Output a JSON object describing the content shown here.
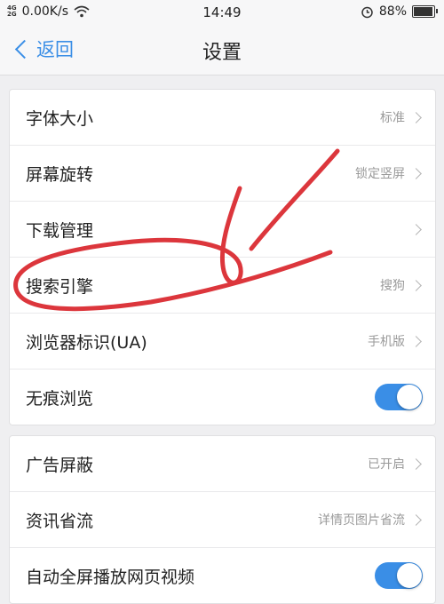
{
  "status_bar": {
    "signal_top": "4G",
    "signal_bottom": "2G",
    "net_speed": "0.00K/s",
    "time": "14:49",
    "battery": "88%",
    "battery_level": 0.88
  },
  "header": {
    "back_label": "返回",
    "title": "设置"
  },
  "group1": [
    {
      "label": "字体大小",
      "value": "标准"
    },
    {
      "label": "屏幕旋转",
      "value": "锁定竖屏"
    },
    {
      "label": "下载管理",
      "value": ""
    },
    {
      "label": "搜索引擎",
      "value": "搜狗"
    },
    {
      "label": "浏览器标识(UA)",
      "value": "手机版"
    },
    {
      "label": "无痕浏览",
      "toggle": true
    }
  ],
  "group2": [
    {
      "label": "广告屏蔽",
      "value": "已开启"
    },
    {
      "label": "资讯省流",
      "value": "详情页图片省流"
    },
    {
      "label": "自动全屏播放网页视频",
      "toggle": true
    }
  ],
  "colors": {
    "accent": "#3a8ee6",
    "annotation": "#d9252b"
  }
}
